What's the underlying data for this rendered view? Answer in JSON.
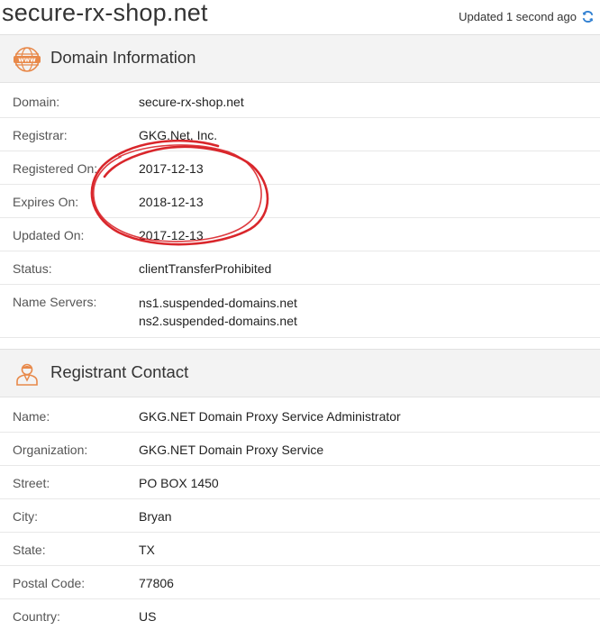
{
  "header": {
    "domain": "secure-rx-shop.net",
    "updated_text": "Updated 1 second ago"
  },
  "domain_info": {
    "title": "Domain Information",
    "icon": "www-globe-icon",
    "rows": [
      {
        "label": "Domain:",
        "value": "secure-rx-shop.net"
      },
      {
        "label": "Registrar:",
        "value": "GKG.Net, Inc."
      },
      {
        "label": "Registered On:",
        "value": "2017-12-13"
      },
      {
        "label": "Expires On:",
        "value": "2018-12-13"
      },
      {
        "label": "Updated On:",
        "value": "2017-12-13"
      },
      {
        "label": "Status:",
        "value": "clientTransferProhibited"
      },
      {
        "label": "Name Servers:",
        "values": [
          "ns1.suspended-domains.net",
          "ns2.suspended-domains.net"
        ]
      }
    ]
  },
  "registrant": {
    "title": "Registrant Contact",
    "icon": "person-icon",
    "rows": [
      {
        "label": "Name:",
        "value": "GKG.NET Domain Proxy Service Administrator"
      },
      {
        "label": "Organization:",
        "value": "GKG.NET Domain Proxy Service"
      },
      {
        "label": "Street:",
        "value": "PO BOX 1450"
      },
      {
        "label": "City:",
        "value": "Bryan"
      },
      {
        "label": "State:",
        "value": "TX"
      },
      {
        "label": "Postal Code:",
        "value": "77806"
      },
      {
        "label": "Country:",
        "value": "US"
      }
    ]
  },
  "colors": {
    "accent_orange": "#e8894a",
    "refresh_blue": "#2f7fd1",
    "annotation_red": "#d9262b"
  }
}
